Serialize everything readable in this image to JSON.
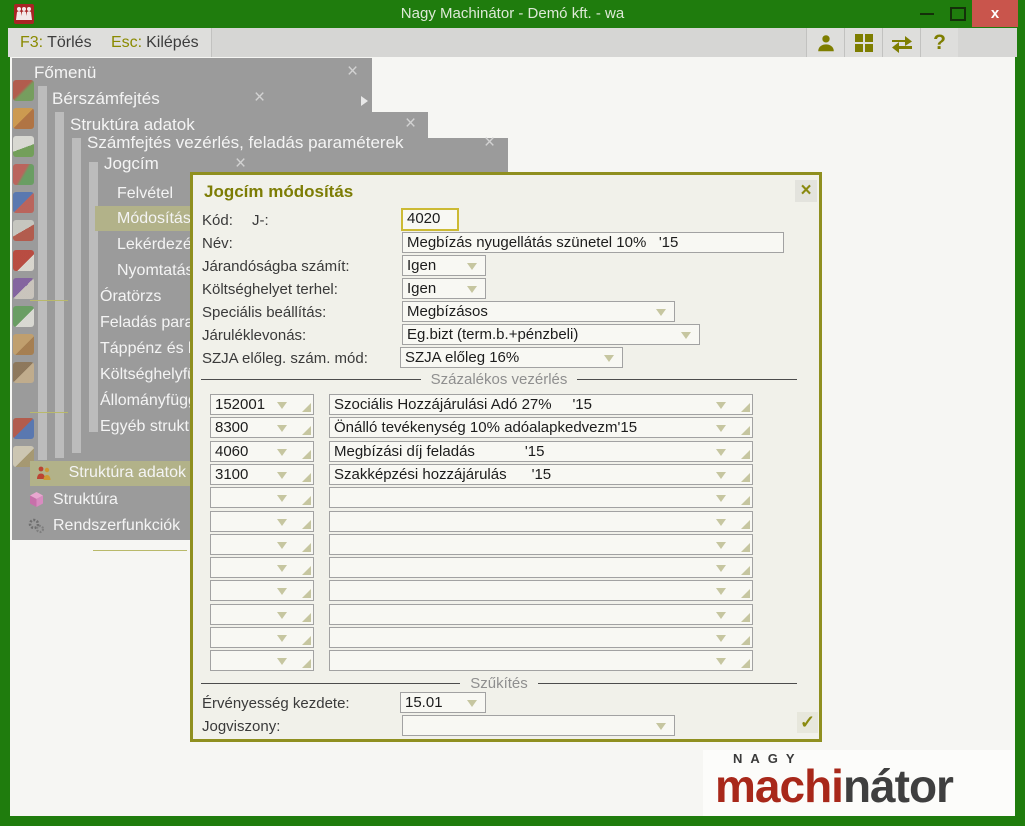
{
  "window": {
    "title": "Nagy Machinátor - Demó kft. - wa",
    "close_glyph": "x"
  },
  "toolbar": {
    "buttons": [
      {
        "key": "F3:",
        "label": "Törlés"
      },
      {
        "key": "Esc:",
        "label": "Kilépés"
      }
    ]
  },
  "cascade": [
    {
      "title": "Főmenü",
      "close_glyph": "×"
    },
    {
      "title": "Bérszámfejtés",
      "close_glyph": "×"
    },
    {
      "title": "Struktúra adatok",
      "close_glyph": "×"
    },
    {
      "title": "Számfejtés vezérlés, feladás paraméterek",
      "close_glyph": "×"
    },
    {
      "title": "Jogcím",
      "close_glyph": "×"
    }
  ],
  "menu": {
    "jogcim_items": [
      "Felvétel",
      "Módosítás",
      "Lekérdezé",
      "Nyomtatás"
    ],
    "active_item": "Módosítás",
    "parent_items": [
      "Óratörzs",
      "Feladás para",
      "Táppénz és b",
      "Költséghelyfü",
      "Állományfügg",
      "Egyéb strukt"
    ],
    "root_items": [
      "Struktúra adatok",
      "Struktúra",
      "Rendszerfunkciók"
    ],
    "active_root": "Struktúra adatok"
  },
  "dialog": {
    "title": "Jogcím módosítás",
    "close_glyph": "×",
    "kod": {
      "label": "Kód:",
      "prefix": "J-:",
      "value": "4020"
    },
    "nev": {
      "label": "Név:",
      "value": "Megbízás nyugellátás szünetel 10%   '15"
    },
    "jarandosagba": {
      "label": "Járandóságba számít:",
      "value": "Igen"
    },
    "koltseghelyet": {
      "label": "Költséghelyet terhel:",
      "value": "Igen"
    },
    "specialis": {
      "label": "Speciális beállítás:",
      "value": "Megbízásos"
    },
    "jarulek": {
      "label": "Járuléklevonás:",
      "value": "Eg.bizt (term.b.+pénzbeli)"
    },
    "szja": {
      "label": "SZJA előleg. szám. mód:",
      "value": "SZJA előleg 16%"
    },
    "percent_section_title": "Százalékos vezérlés",
    "percent_rows": [
      {
        "code": "152001",
        "name": "Szociális Hozzájárulási Adó 27%     '15"
      },
      {
        "code": "8300",
        "name": "Önálló tevékenység 10% adóalapkedvezm'15"
      },
      {
        "code": "4060",
        "name": "Megbízási díj feladás            '15"
      },
      {
        "code": "3100",
        "name": "Szakképzési hozzájárulás      '15"
      },
      {
        "code": "",
        "name": ""
      },
      {
        "code": "",
        "name": ""
      },
      {
        "code": "",
        "name": ""
      },
      {
        "code": "",
        "name": ""
      },
      {
        "code": "",
        "name": ""
      },
      {
        "code": "",
        "name": ""
      },
      {
        "code": "",
        "name": ""
      },
      {
        "code": "",
        "name": ""
      }
    ],
    "filter_section_title": "Szűkítés",
    "ervenyesseg": {
      "label": "Érvényesség kezdete:",
      "value": "15.01"
    },
    "jogviszony": {
      "label": "Jogviszony:",
      "value": ""
    },
    "confirm_glyph": "✓"
  },
  "logo": {
    "top": "NAGY",
    "red": "machi",
    "dark": "nátor"
  }
}
